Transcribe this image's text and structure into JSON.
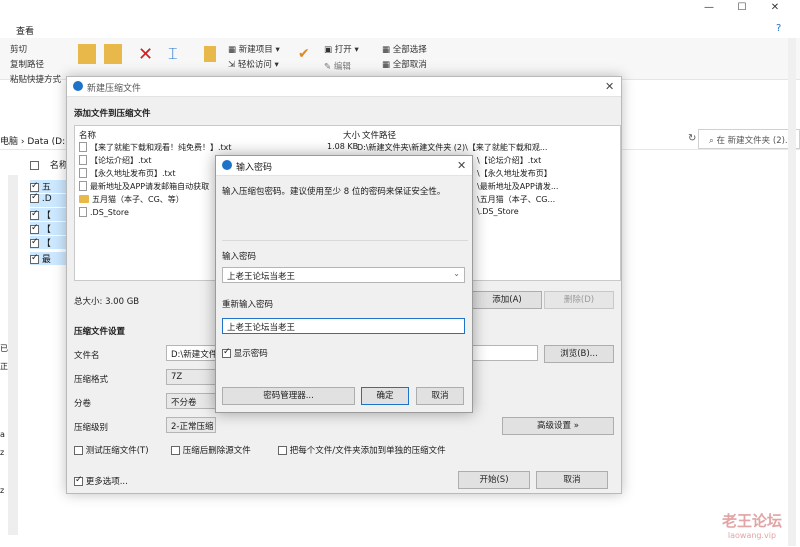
{
  "explorer": {
    "tab_view": "查看",
    "ribbon": {
      "cut": "剪切",
      "copy_path": "复制路径",
      "paste_shortcut": "粘贴快捷方式",
      "copy_to": "移动到",
      "move_to": "复制到",
      "delete": "删除",
      "rename": "重命名",
      "new_folder": "新建",
      "new_item": "新建项目",
      "easy_access": "轻松访问",
      "open": "打开",
      "edit": "编辑",
      "select_all": "全部选择",
      "select_none": "全部取消"
    },
    "address": "电脑 › Data (D:)",
    "search_placeholder": "在 新建文件夹 (2)...",
    "column_name": "名称",
    "file_stubs": [
      "五",
      ".D",
      "【",
      "【",
      "【",
      "最"
    ],
    "left_stubs": [
      "已",
      "正",
      "a",
      "z",
      "z"
    ],
    "watermark_cn": "老王论坛",
    "watermark_url": "laowang.vip"
  },
  "compress": {
    "title": "新建压缩文件",
    "section_add": "添加文件到压缩文件",
    "col_name": "名称",
    "col_size": "大小",
    "col_path": "文件路径",
    "files": [
      {
        "name": "【来了就能下载和观看！纯免费！】.txt",
        "size": "1.08 KB",
        "path": "D:\\新建文件夹\\新建文件夹 (2)\\【来了就能下载和观...",
        "type": "doc"
      },
      {
        "name": "【论坛介绍】.txt",
        "size": "",
        "path": "\\【论坛介绍】.txt",
        "type": "doc"
      },
      {
        "name": "【永久地址发布页】.txt",
        "size": "",
        "path": "\\【永久地址发布页】",
        "type": "doc"
      },
      {
        "name": "最新地址及APP请发邮箱自动获取",
        "size": "",
        "path": "\\最新地址及APP请发...",
        "type": "doc"
      },
      {
        "name": "五月猫（本子、CG、等）",
        "size": "",
        "path": "\\五月猫（本子、CG...",
        "type": "folder"
      },
      {
        "name": ".DS_Store",
        "size": "",
        "path": "\\.DS_Store",
        "type": "doc"
      }
    ],
    "total_size": "总大小: 3.00 GB",
    "add_btn": "添加(A)",
    "delete_btn": "删除(D)",
    "settings_title": "压缩文件设置",
    "filename_label": "文件名",
    "filename_value": "D:\\新建文件",
    "browse_btn": "浏览(B)...",
    "format_label": "压缩格式",
    "format_value": "7Z",
    "split_label": "分卷",
    "split_value": "不分卷",
    "level_label": "压缩级别",
    "level_value": "2-正常压缩",
    "advanced_btn": "高级设置 »",
    "test_chk": "测试压缩文件(T)",
    "delete_after_chk": "压缩后删除源文件",
    "separate_chk": "把每个文件/文件夹添加到单独的压缩文件",
    "more_options": "更多选项...",
    "start_btn": "开始(S)",
    "cancel_btn": "取消"
  },
  "password": {
    "title": "输入密码",
    "hint": "输入压缩包密码。建议使用至少 8 位的密码来保证安全性。",
    "enter_label": "输入密码",
    "enter_value": "上老王论坛当老王",
    "reenter_label": "重新输入密码",
    "reenter_value": "上老王论坛当老王",
    "show_pwd": "显示密码",
    "manager_btn": "密码管理器...",
    "ok_btn": "确定",
    "cancel_btn": "取消"
  }
}
